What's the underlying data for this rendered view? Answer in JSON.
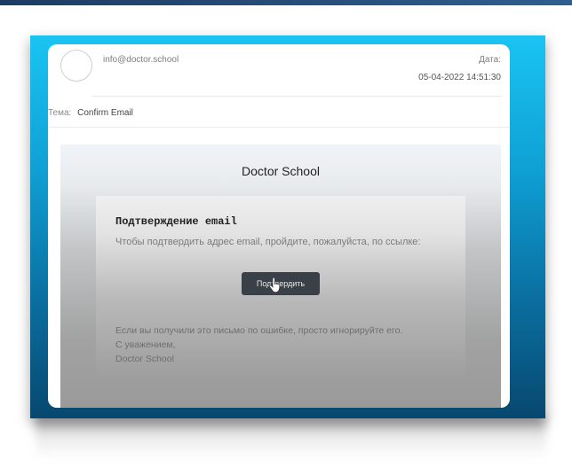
{
  "email": {
    "sender": "info@doctor.school",
    "date_label": "Дата:",
    "date_value": "05-04-2022 14:51:30",
    "subject_label": "Тема:",
    "subject_value": "Confirm Email"
  },
  "body": {
    "brand": "Doctor School",
    "heading": "Подтверждение email",
    "instruction": "Чтобы подтвердить адрес email, пройдите, пожалуйста, по ссылке:",
    "button_label": "Подтвердить",
    "footer": {
      "line1": "Если вы получили это письмо по ошибке, просто игнорируйте его.",
      "line2": "С уважением,",
      "line3": "Doctor School"
    }
  },
  "icons": {
    "cursor": "hand-pointer-icon",
    "avatar": "avatar-circle"
  },
  "colors": {
    "frame_top": "#1ac4f2",
    "frame_bottom": "#07486f",
    "button": "#3a4048"
  }
}
